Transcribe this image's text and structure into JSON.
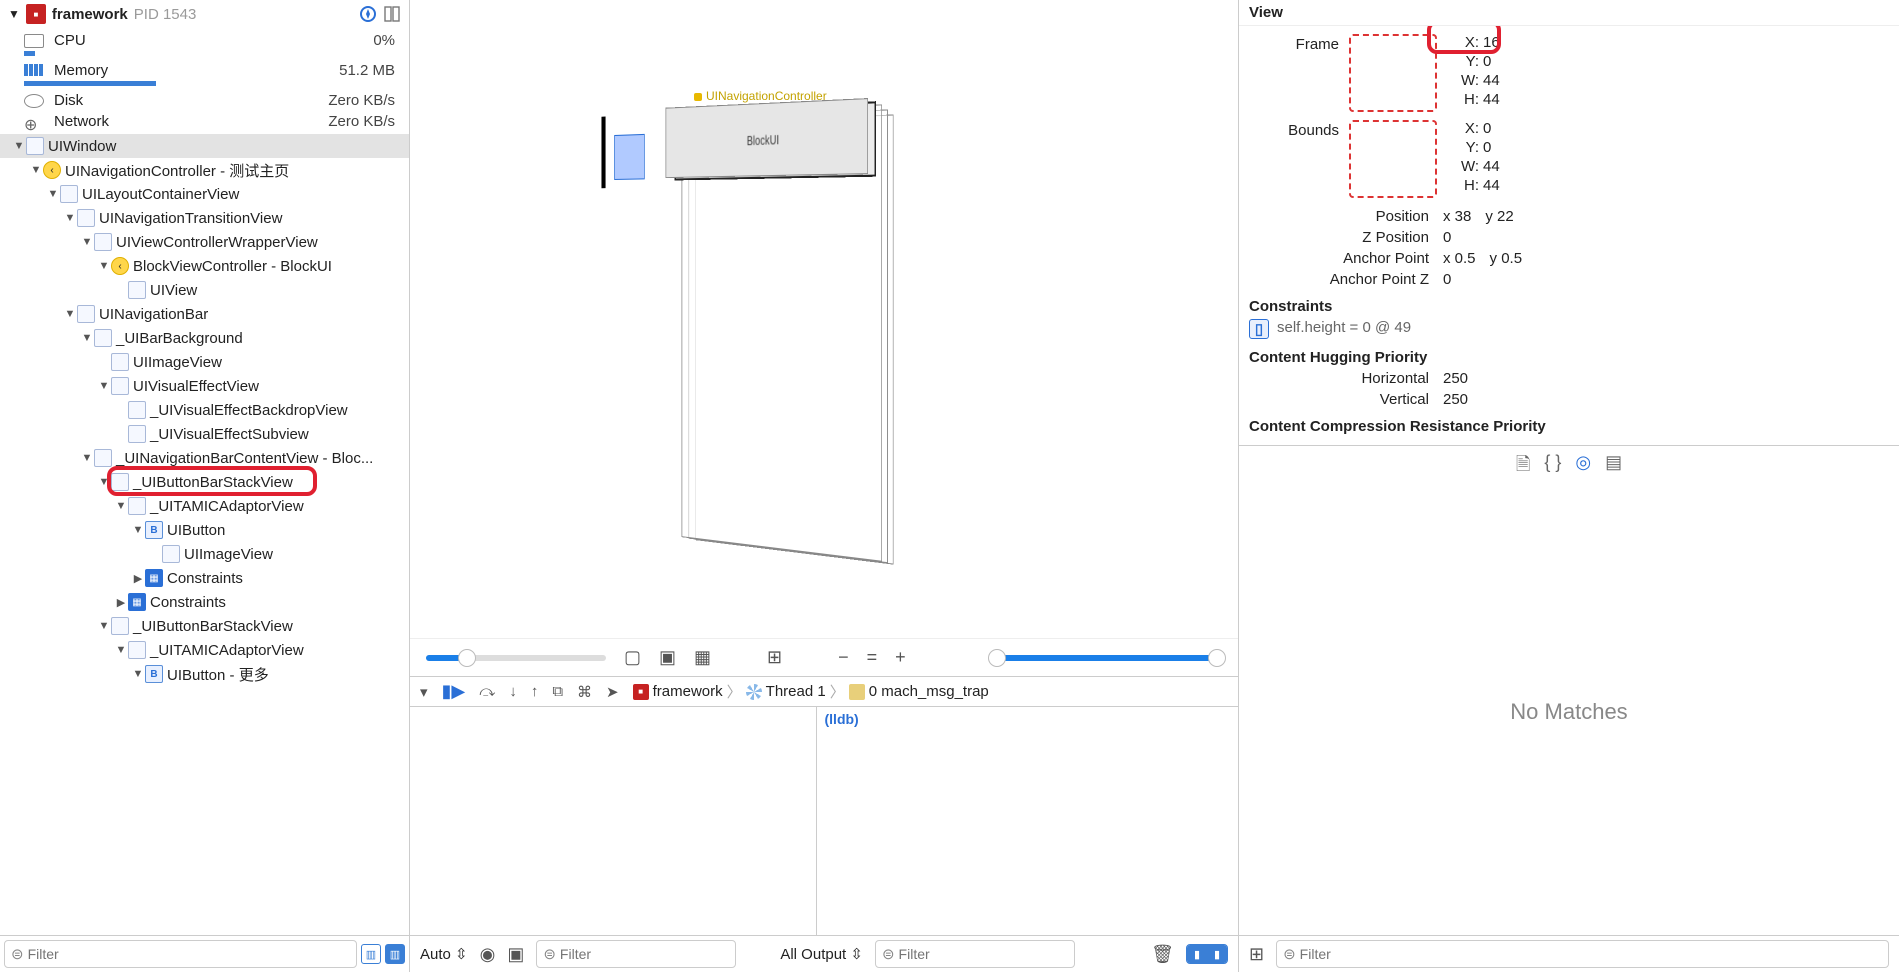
{
  "header": {
    "process": "framework",
    "pid": "PID 1543"
  },
  "stats": {
    "cpu": {
      "label": "CPU",
      "value": "0%",
      "meter_pct": 3
    },
    "memory": {
      "label": "Memory",
      "value": "51.2 MB",
      "meter_pct": 35
    },
    "disk": {
      "label": "Disk",
      "value": "Zero KB/s"
    },
    "network": {
      "label": "Network",
      "value": "Zero KB/s"
    }
  },
  "tree": [
    {
      "depth": 0,
      "open": true,
      "icon": "view",
      "label": "UIWindow",
      "sel": true
    },
    {
      "depth": 1,
      "open": true,
      "icon": "yellow",
      "label": "UINavigationController - 测试主页"
    },
    {
      "depth": 2,
      "open": true,
      "icon": "view",
      "label": "UILayoutContainerView"
    },
    {
      "depth": 3,
      "open": true,
      "icon": "view",
      "label": "UINavigationTransitionView"
    },
    {
      "depth": 4,
      "open": true,
      "icon": "view",
      "label": "UIViewControllerWrapperView"
    },
    {
      "depth": 5,
      "open": true,
      "icon": "yellow",
      "label": "BlockViewController - BlockUI"
    },
    {
      "depth": 6,
      "open": false,
      "icon": "view",
      "label": "UIView",
      "noDisc": true
    },
    {
      "depth": 3,
      "open": true,
      "icon": "view",
      "label": "UINavigationBar"
    },
    {
      "depth": 4,
      "open": true,
      "icon": "view",
      "label": "_UIBarBackground"
    },
    {
      "depth": 5,
      "open": false,
      "icon": "view",
      "label": "UIImageView",
      "noDisc": true
    },
    {
      "depth": 5,
      "open": true,
      "icon": "view",
      "label": "UIVisualEffectView"
    },
    {
      "depth": 6,
      "open": false,
      "icon": "view",
      "label": "_UIVisualEffectBackdropView",
      "noDisc": true
    },
    {
      "depth": 6,
      "open": false,
      "icon": "view",
      "label": "_UIVisualEffectSubview",
      "noDisc": true
    },
    {
      "depth": 4,
      "open": true,
      "icon": "view",
      "label": "_UINavigationBarContentView - Bloc..."
    },
    {
      "depth": 5,
      "open": true,
      "icon": "view",
      "label": "_UIButtonBarStackView",
      "hl": true
    },
    {
      "depth": 6,
      "open": true,
      "icon": "view",
      "label": "_UITAMICAdaptorView"
    },
    {
      "depth": 7,
      "open": true,
      "icon": "blueB",
      "label": "UIButton"
    },
    {
      "depth": 8,
      "open": false,
      "icon": "view",
      "label": "UIImageView",
      "noDisc": true
    },
    {
      "depth": 7,
      "open": false,
      "icon": "cons",
      "label": "Constraints",
      "disc": "right"
    },
    {
      "depth": 6,
      "open": false,
      "icon": "cons",
      "label": "Constraints",
      "disc": "right"
    },
    {
      "depth": 5,
      "open": true,
      "icon": "view",
      "label": "_UIButtonBarStackView"
    },
    {
      "depth": 6,
      "open": true,
      "icon": "view",
      "label": "_UITAMICAdaptorView"
    },
    {
      "depth": 7,
      "open": true,
      "icon": "blueB",
      "label": "UIButton - 更多"
    }
  ],
  "filter": {
    "placeholder": "Filter"
  },
  "canvas": {
    "controller_label": "UINavigationController",
    "title_label": "BlockUI"
  },
  "debug": {
    "crumb_app": "framework",
    "crumb_thread": "Thread 1",
    "crumb_frame": "0 mach_msg_trap",
    "lldb_prompt": "(lldb)"
  },
  "bottom": {
    "auto": "Auto",
    "all_output": "All Output",
    "filter_placeholder": "Filter"
  },
  "inspector": {
    "header": "View",
    "frame": {
      "label": "Frame",
      "x": "16",
      "y": "0",
      "w": "44",
      "h": "44"
    },
    "bounds": {
      "label": "Bounds",
      "x": "0",
      "y": "0",
      "w": "44",
      "h": "44"
    },
    "position": {
      "label": "Position",
      "x": "38",
      "y": "22"
    },
    "zposition": {
      "label": "Z Position",
      "v": "0"
    },
    "anchor": {
      "label": "Anchor Point",
      "x": "0.5",
      "y": "0.5"
    },
    "anchorZ": {
      "label": "Anchor Point Z",
      "v": "0"
    },
    "constraints_title": "Constraints",
    "constraint0": "self.height = 0 @ 49",
    "hugging_title": "Content Hugging Priority",
    "hug_h_label": "Horizontal",
    "hug_h": "250",
    "hug_v_label": "Vertical",
    "hug_v": "250",
    "compression_title": "Content Compression Resistance Priority",
    "nomatches": "No Matches"
  }
}
